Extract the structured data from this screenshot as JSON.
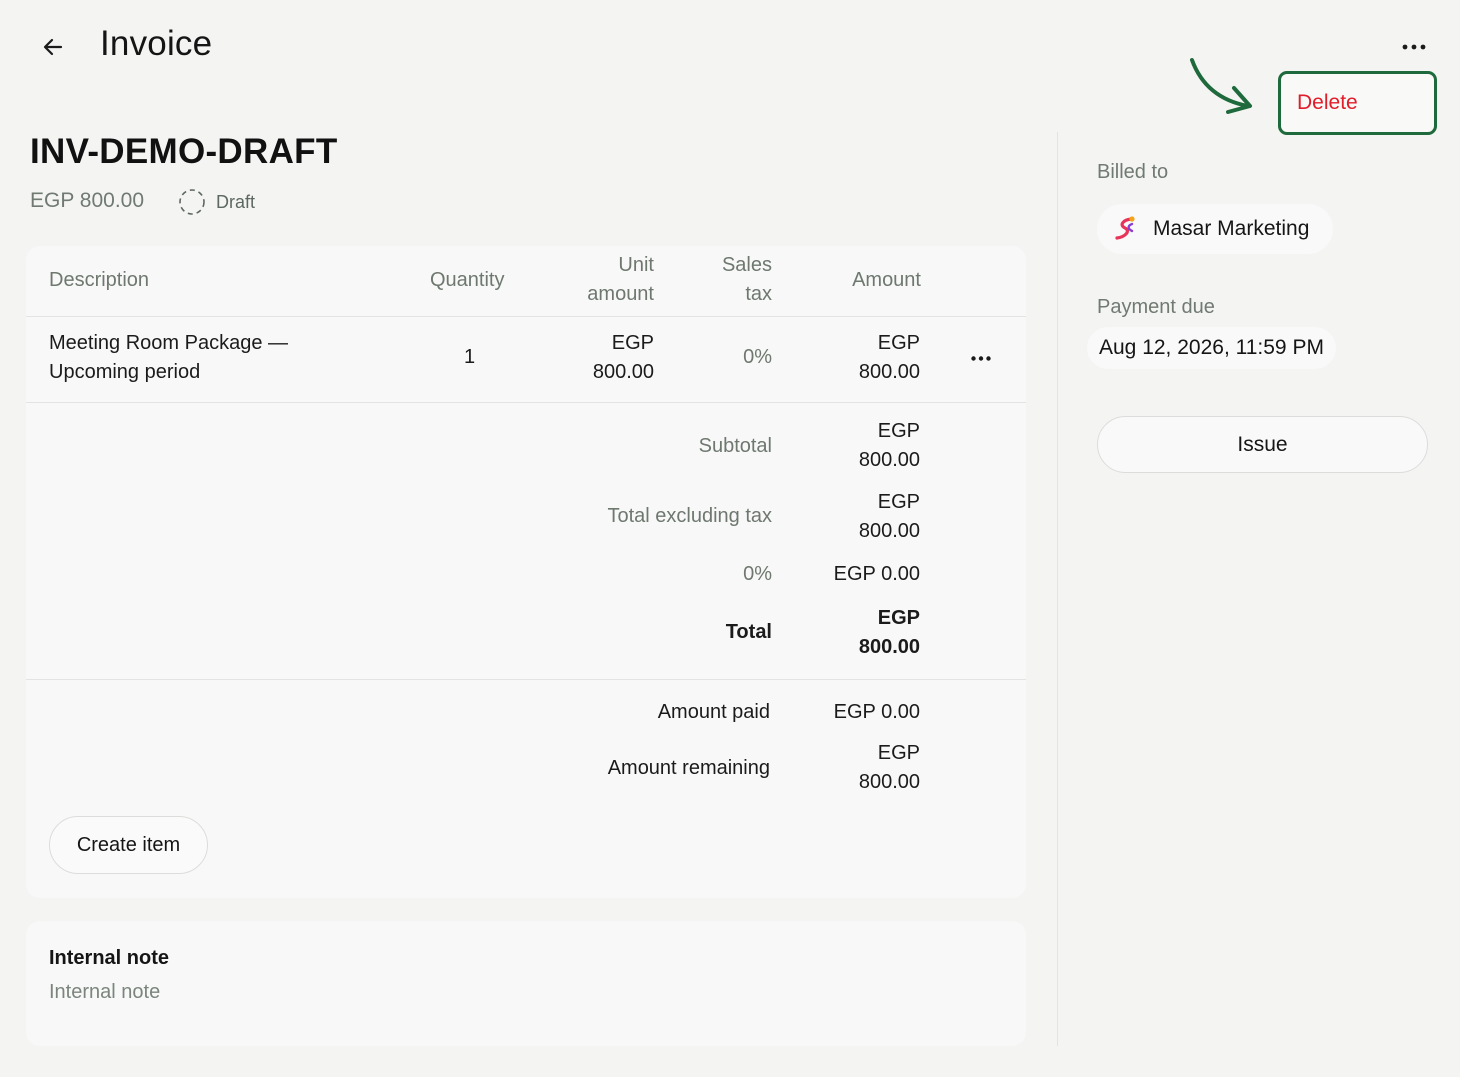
{
  "header": {
    "title": "Invoice",
    "back_icon": "arrow-left-icon",
    "more_icon": "more-horizontal-icon",
    "delete_label": "Delete",
    "delete_color": "#e11d2a",
    "annotation_color": "#1f6a3c"
  },
  "invoice": {
    "number": "INV-DEMO-DRAFT",
    "amount": "EGP 800.00",
    "status": "Draft",
    "status_icon": "dashed-circle-icon"
  },
  "table": {
    "columns": {
      "description": "Description",
      "quantity": "Quantity",
      "unit_amount": [
        "Unit",
        "amount"
      ],
      "sales_tax": [
        "Sales",
        "tax"
      ],
      "amount": "Amount"
    },
    "rows": [
      {
        "description": [
          "Meeting Room Package —",
          "Upcoming period"
        ],
        "quantity": "1",
        "unit_amount": [
          "EGP",
          "800.00"
        ],
        "sales_tax": "0%",
        "amount": [
          "EGP",
          "800.00"
        ]
      }
    ]
  },
  "totals": {
    "subtotal_label": "Subtotal",
    "subtotal_value": [
      "EGP",
      "800.00"
    ],
    "excl_tax_label": "Total excluding tax",
    "excl_tax_value": [
      "EGP",
      "800.00"
    ],
    "tax_label": "0%",
    "tax_value": "EGP 0.00",
    "total_label": "Total",
    "total_value": [
      "EGP",
      "800.00"
    ],
    "paid_label": "Amount paid",
    "paid_value": "EGP 0.00",
    "remaining_label": "Amount remaining",
    "remaining_value": [
      "EGP",
      "800.00"
    ]
  },
  "actions": {
    "create_item_label": "Create item"
  },
  "note": {
    "title": "Internal note",
    "placeholder": "Internal note"
  },
  "side": {
    "billed_to_label": "Billed to",
    "customer_name": "Masar Marketing",
    "customer_logo": "masar-logo-icon",
    "payment_due_label": "Payment due",
    "payment_due_value": "Aug 12, 2026, 11:59 PM",
    "issue_label": "Issue"
  }
}
